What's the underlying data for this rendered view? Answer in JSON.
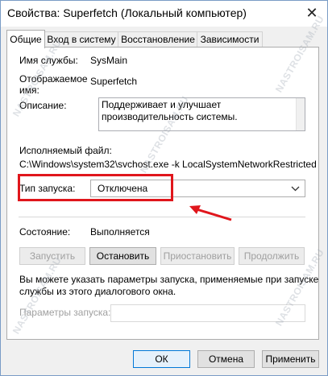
{
  "window": {
    "title": "Свойства: Superfetch (Локальный компьютер)",
    "close_glyph": "✕"
  },
  "tabs": [
    {
      "label": "Общие",
      "active": true
    },
    {
      "label": "Вход в систему",
      "active": false
    },
    {
      "label": "Восстановление",
      "active": false
    },
    {
      "label": "Зависимости",
      "active": false
    }
  ],
  "general": {
    "service_name_label": "Имя службы:",
    "service_name_value": "SysMain",
    "display_name_label_1": "Отображаемое",
    "display_name_label_2": "имя:",
    "display_name_value": "Superfetch",
    "description_label": "Описание:",
    "description_value": "Поддерживает и улучшает производительность системы.",
    "exe_label": "Исполняемый файл:",
    "exe_value": "C:\\Windows\\system32\\svchost.exe -k LocalSystemNetworkRestricted",
    "startup_type_label": "Тип запуска:",
    "startup_type_value": "Отключена",
    "status_label": "Состояние:",
    "status_value": "Выполняется",
    "buttons": {
      "start": "Запустить",
      "stop": "Остановить",
      "pause": "Приостановить",
      "resume": "Продолжить"
    },
    "hint_line_1": "Вы можете указать параметры запуска, применяемые при запуске",
    "hint_line_2": "службы из этого диалогового окна.",
    "params_label": "Параметры запуска:",
    "params_value": ""
  },
  "footer": {
    "ok": "ОК",
    "cancel": "Отмена",
    "apply": "Применить"
  },
  "watermark": "NASTROISAM.RU",
  "colors": {
    "highlight_red": "#e0161c",
    "default_button_border": "#0078d7"
  },
  "icons": {
    "close": "close-icon",
    "dropdown": "chevron-down-icon",
    "annotation_arrow": "red-arrow-icon"
  }
}
